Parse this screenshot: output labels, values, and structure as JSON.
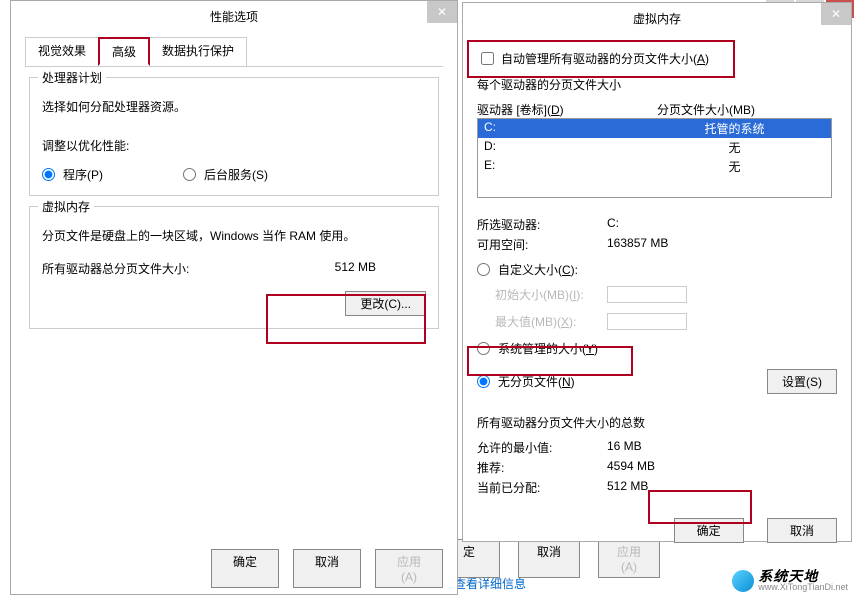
{
  "win1": {
    "title": "性能选项",
    "tabs": [
      "视觉效果",
      "高级",
      "数据执行保护"
    ],
    "processor": {
      "legend": "处理器计划",
      "desc": "选择如何分配处理器资源。",
      "adjust_label": "调整以优化性能:",
      "opt_programs": "程序(P)",
      "opt_bg": "后台服务(S)"
    },
    "vm": {
      "legend": "虚拟内存",
      "desc": "分页文件是硬盘上的一块区域，Windows 当作 RAM 使用。",
      "total_label": "所有驱动器总分页文件大小:",
      "total_value": "512 MB",
      "change_btn": "更改(C)..."
    },
    "buttons": {
      "ok": "确定",
      "cancel": "取消",
      "apply": "应用(A)"
    }
  },
  "win2": {
    "title": "虚拟内存",
    "auto_manage": "自动管理所有驱动器的分页文件大小(A)",
    "each_drive_label": "每个驱动器的分页文件大小",
    "drive_hdr": "驱动器 [卷标](D)",
    "paging_hdr": "分页文件大小(MB)",
    "drives": [
      {
        "d": "C:",
        "p": "托管的系统"
      },
      {
        "d": "D:",
        "p": "无"
      },
      {
        "d": "E:",
        "p": "无"
      }
    ],
    "selected_drive_label": "所选驱动器:",
    "selected_drive_value": "C:",
    "free_label": "可用空间:",
    "free_value": "163857 MB",
    "custom_size": "自定义大小(C):",
    "init_label": "初始大小(MB)(I):",
    "max_label": "最大值(MB)(X):",
    "sys_managed": "系统管理的大小(Y)",
    "no_paging": "无分页文件(N)",
    "set_btn": "设置(S)",
    "totals_legend": "所有驱动器分页文件大小的总数",
    "min_label": "允许的最小值:",
    "min_value": "16 MB",
    "rec_label": "推荐:",
    "rec_value": "4594 MB",
    "cur_label": "当前已分配:",
    "cur_value": "512 MB",
    "ok": "确定",
    "cancel": "取消"
  },
  "sys": {
    "ok_frag": "定",
    "cancel": "取消",
    "apply": "应用(A)",
    "detail_link": "中查看详细信息"
  },
  "logo": {
    "name": "系统天地",
    "url": "www.XiTongTianDi.net"
  }
}
